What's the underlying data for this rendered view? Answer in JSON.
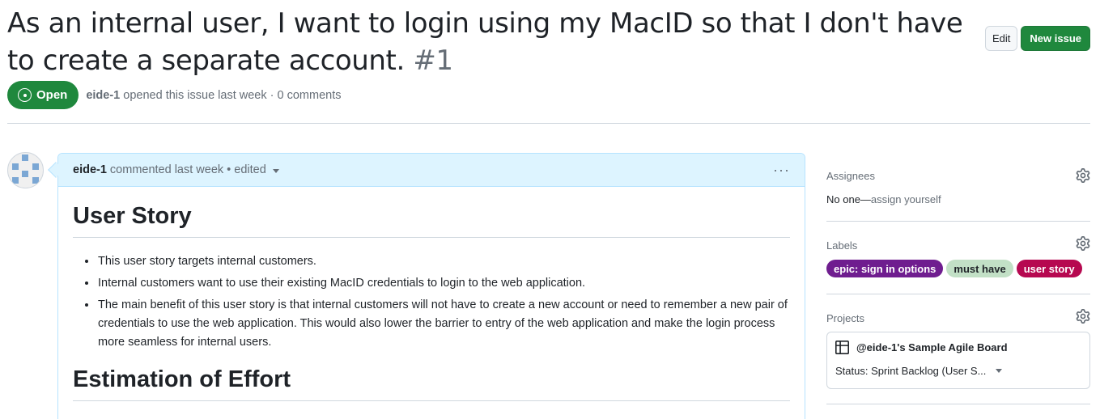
{
  "issue": {
    "title": "As an internal user, I want to login using my MacID so that I don't have to create a separate account.",
    "number": "#1",
    "state": "Open",
    "author": "eide-1",
    "meta_suffix": "opened this issue last week · 0 comments"
  },
  "header_actions": {
    "edit_label": "Edit",
    "new_issue_label": "New issue"
  },
  "comment": {
    "author": "eide-1",
    "meta": "commented last week • edited",
    "menu_glyph": "···",
    "heading1": "User Story",
    "bullets": [
      "This user story targets internal customers.",
      "Internal customers want to use their existing MacID credentials to login to the web application.",
      "The main benefit of this user story is that internal customers will not have to create a new account or need to remember a new pair of credentials to use the web application. This would also lower the barrier to entry of the web application and make the login process more seamless for internal users."
    ],
    "heading2": "Estimation of Effort"
  },
  "sidebar": {
    "assignees": {
      "heading": "Assignees",
      "none_text": "No one—",
      "assign_link": "assign yourself"
    },
    "labels": {
      "heading": "Labels",
      "items": [
        {
          "name": "epic: sign in options",
          "bg": "#6f1d8f",
          "fg": "#ffffff"
        },
        {
          "name": "must have",
          "bg": "#c2e0c6",
          "fg": "#1f2328"
        },
        {
          "name": "user story",
          "bg": "#b60850",
          "fg": "#ffffff"
        }
      ]
    },
    "projects": {
      "heading": "Projects",
      "board_name": "@eide-1's Sample Agile Board",
      "status": "Status: Sprint Backlog (User S..."
    }
  },
  "colors": {
    "accent_green": "#1f883d",
    "comment_header_bg": "#ddf4ff",
    "comment_border": "#b6e3ff",
    "muted_text": "#656d76"
  }
}
